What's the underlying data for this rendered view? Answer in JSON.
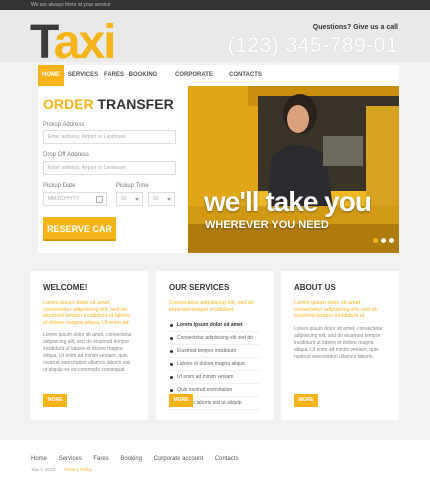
{
  "topbar": {
    "text": "We are always there at your service"
  },
  "header": {
    "logo_part1": "T",
    "logo_part2": "axi",
    "questions": "Questions? Give us a call",
    "phone": "(123) 345-789-01"
  },
  "nav": {
    "items": [
      "Home",
      "Services",
      "Fares",
      "Booking",
      "Corporate account",
      "Contacts"
    ],
    "active": "Home"
  },
  "order_form": {
    "title_a": "ORDER",
    "title_b": "TRANSFER",
    "pickup_label": "Pickup Address",
    "pickup_placeholder": "Enter address, Airport or Landmark",
    "dropoff_label": "Drop Off Address",
    "dropoff_placeholder": "Enter address, Airport or Landmark",
    "date_label": "Pickup Date",
    "date_placeholder": "MM/DD/YYYY",
    "time_label": "Pickup Time",
    "hour_value": "00",
    "minute_value": "00",
    "button": "RESERVE CAR"
  },
  "hero": {
    "line1": "we'll take you",
    "line2": "WHEREVER YOU NEED",
    "slides": 3,
    "active_slide": 1
  },
  "cards": {
    "welcome": {
      "title": "WELCOME!",
      "lead": "Lorem ipsum dolor sit amet, consectetur adipisicing elit, sed do eiusmod tempor incididunt ut labore et dolore magna aliqua. Ut enim ad",
      "text": "Lorem ipsum dolor sit amet, consectetur adipisicing elit, sed do eiusmod tempor incididunt ut labore et dolore magna aliqua. Ut enim ad minim veniam, quis nostrud exercitation ullamco laboris nisi ut aliquip ex ea commodo consequat.",
      "more": "MORE"
    },
    "services": {
      "title": "OUR SERVICES",
      "lead": "Consectetur adipisicing elit, sed do eiusmod tempor incididunt",
      "items": [
        "Lorem ipsum dolor sit amet",
        "Consectetur adipisicing elit sed do",
        "Eiusmod tempor incididunt",
        "Labore et dolore magna aliqua",
        "Ut enim ad minim veniam",
        "Quis nostrud exercitation",
        "Ullamco laboris nisi ut aliquip"
      ],
      "more": "MORE"
    },
    "about": {
      "title": "ABOUT US",
      "lead": "Lorem ipsum dolor sit amet, consectetur adipisicing elit, sed do eiusmod tempor incididunt ut",
      "text": "Lorem ipsum dolor sit amet, consectetur adipisicing elit, sed do eiusmod tempor incididunt ut labore et dolore magna aliqua. Ut enim ad minim veniam, quis nostrud exercitation ullamco laboris.",
      "more": "MORE"
    }
  },
  "footer": {
    "links": [
      "Home",
      "Services",
      "Fares",
      "Booking",
      "Corporate account",
      "Contacts"
    ],
    "copyright": "Taxi © 2013",
    "privacy": "Privacy Policy"
  },
  "colors": {
    "accent": "#f6b419",
    "dark": "#333333"
  }
}
